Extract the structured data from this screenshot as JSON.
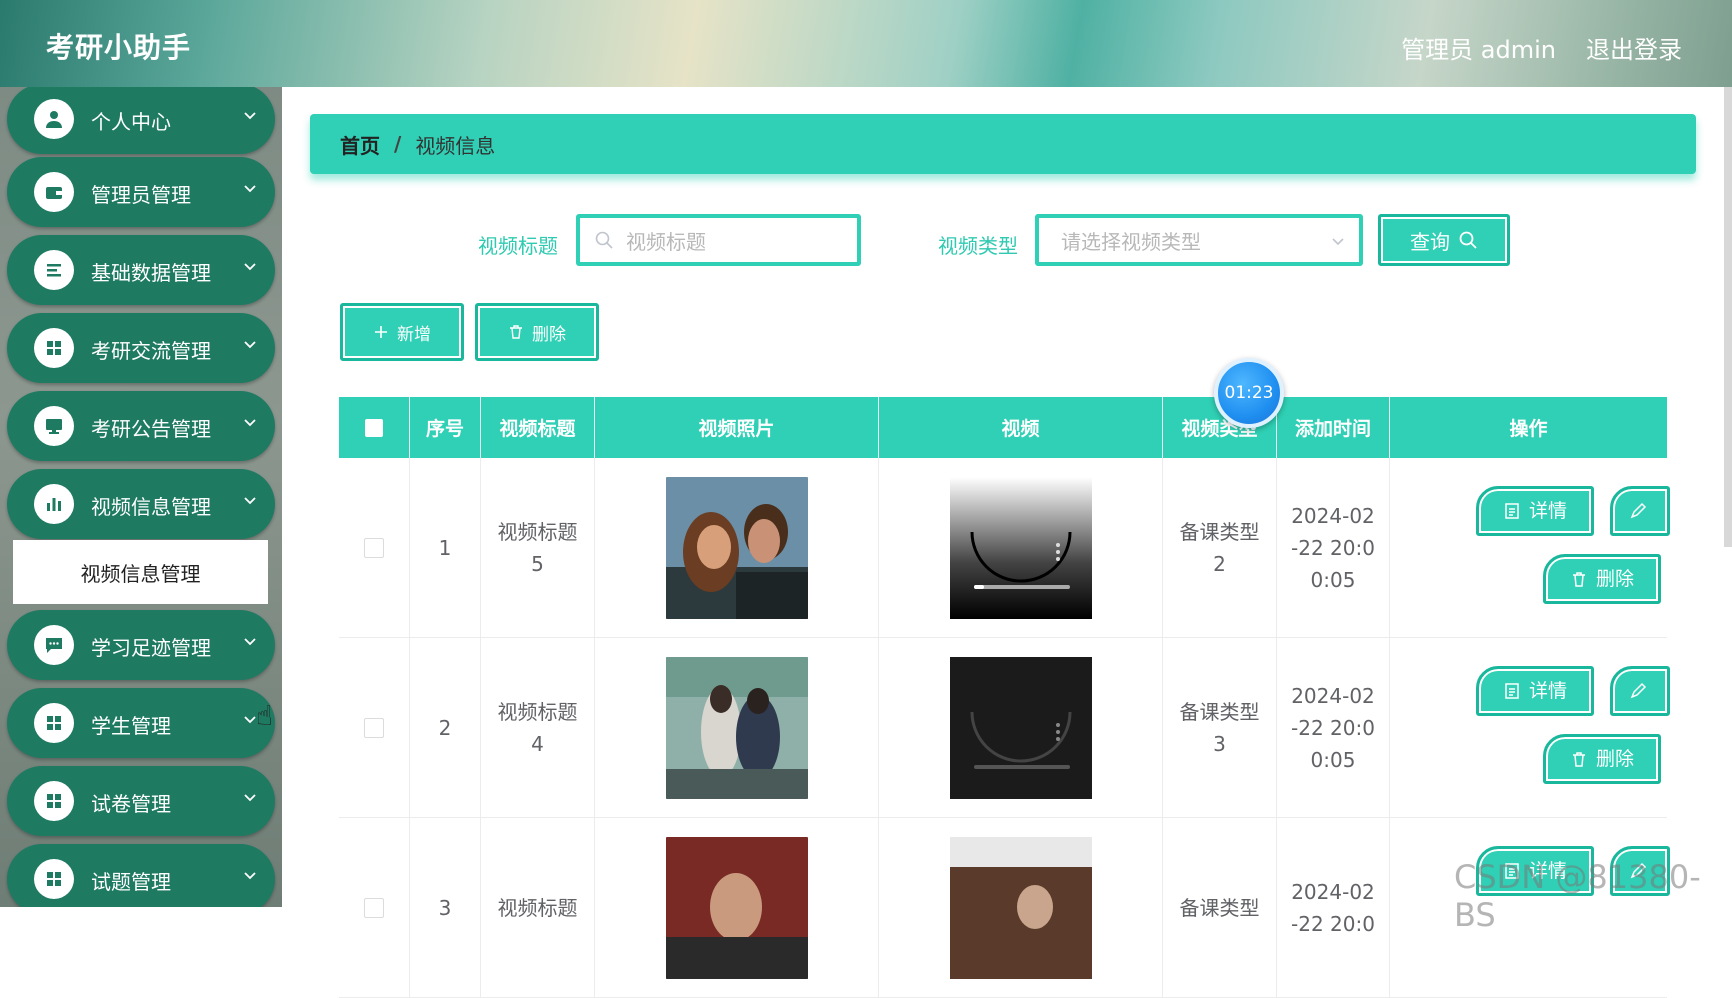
{
  "header": {
    "brand": "考研小助手",
    "admin_label": "管理员 admin",
    "logout_label": "退出登录"
  },
  "sidebar": {
    "items": [
      {
        "label": "个人中心",
        "icon": "user-icon"
      },
      {
        "label": "管理员管理",
        "icon": "wallet-icon"
      },
      {
        "label": "基础数据管理",
        "icon": "list-icon"
      },
      {
        "label": "考研交流管理",
        "icon": "grid-icon"
      },
      {
        "label": "考研公告管理",
        "icon": "monitor-icon"
      },
      {
        "label": "视频信息管理",
        "icon": "bar-chart-icon"
      },
      {
        "label": "学习足迹管理",
        "icon": "chat-icon"
      },
      {
        "label": "学生管理",
        "icon": "grid-icon"
      },
      {
        "label": "试卷管理",
        "icon": "grid-icon"
      },
      {
        "label": "试题管理",
        "icon": "grid-icon"
      }
    ],
    "submenu_label": "视频信息管理"
  },
  "breadcrumb": {
    "home": "首页",
    "separator": "/",
    "current": "视频信息"
  },
  "search": {
    "title_label": "视频标题",
    "title_placeholder": "视频标题",
    "type_label": "视频类型",
    "type_placeholder": "请选择视频类型",
    "query_label": "查询"
  },
  "actions": {
    "add_label": "新增",
    "delete_label": "删除"
  },
  "table": {
    "headers": [
      "序号",
      "视频标题",
      "视频照片",
      "视频",
      "视频类型",
      "添加时间",
      "操作"
    ],
    "rows": [
      {
        "index": "1",
        "title": "视频标题\n5",
        "type": "备课类型\n2",
        "time": "2024-02\n-22 20:0\n0:05"
      },
      {
        "index": "2",
        "title": "视频标题\n4",
        "type": "备课类型\n3",
        "time": "2024-02\n-22 20:0\n0:05"
      },
      {
        "index": "3",
        "title": "视频标题",
        "type": "备课类型",
        "time": "2024-02\n-22 20:0"
      }
    ],
    "op_detail": "详情",
    "op_delete": "删除"
  },
  "overlay": {
    "timer": "01:23",
    "watermark": "CSDN @81380-BS"
  },
  "colors": {
    "accent": "#2fd0b5",
    "sidebar_item": "#1f7a62",
    "label": "#2fcab1"
  }
}
